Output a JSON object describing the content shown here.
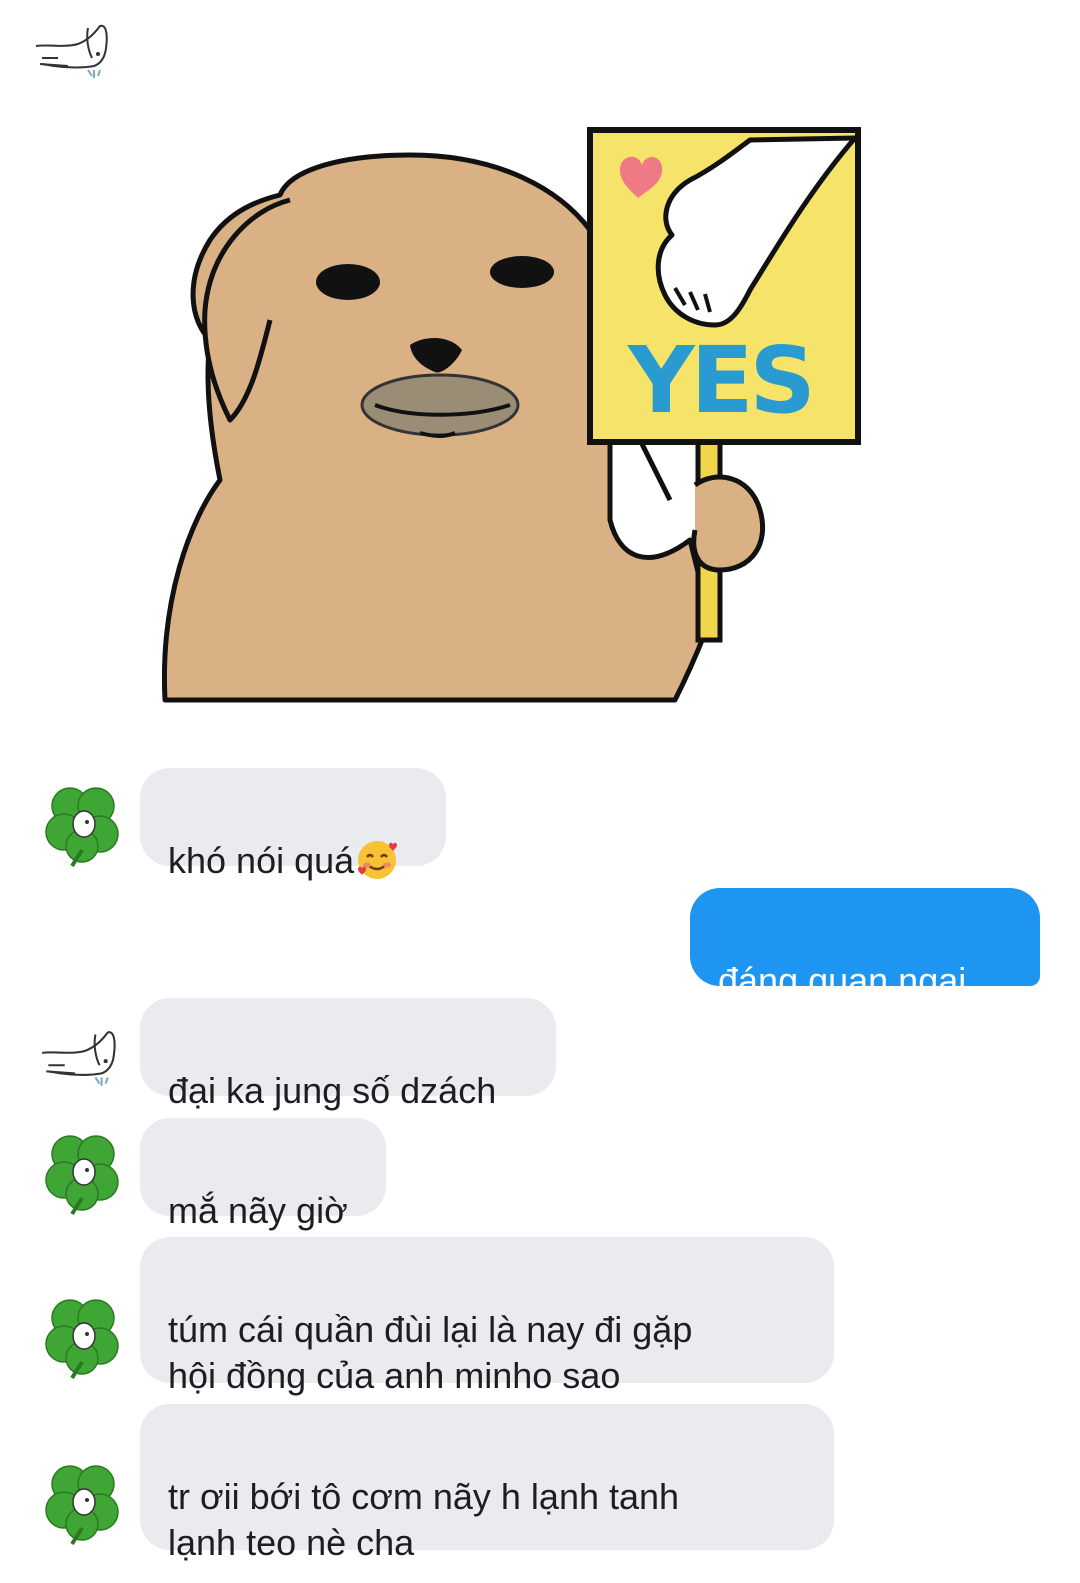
{
  "conversation": {
    "messages": [
      {
        "sender": "dog",
        "type": "sticker",
        "sticker_name": "dog-yes-sign-sticker",
        "sign_text": "YES"
      },
      {
        "sender": "clover",
        "type": "text",
        "text": "khó nói quá",
        "emoji": "smiling-face-with-hearts-emoji"
      },
      {
        "sender": "me",
        "type": "text",
        "text": "đáng quan ngại.."
      },
      {
        "sender": "dog",
        "type": "text",
        "text": "đại ka jung số dzách"
      },
      {
        "sender": "clover",
        "type": "text",
        "text": "mắ nãy giờ"
      },
      {
        "sender": "clover",
        "type": "text",
        "text": "túm cái quần đùi lại là nay đi gặp\nhội đồng của anh minho sao"
      },
      {
        "sender": "clover",
        "type": "text",
        "text": "tr ơii bới tô cơm nãy h lạnh tanh\nlạnh teo nè cha"
      }
    ]
  },
  "colors": {
    "incoming_bubble": "#e9ebee",
    "outgoing_bubble": "#1e95f1",
    "sticker_dog": "#d9b184",
    "sticker_sign": "#f6e36a",
    "sticker_yes_text": "#2a9bd0"
  },
  "icons": {
    "dog_avatar": "dog-sketch-avatar-icon",
    "clover_avatar": "four-leaf-clover-avatar-icon"
  }
}
